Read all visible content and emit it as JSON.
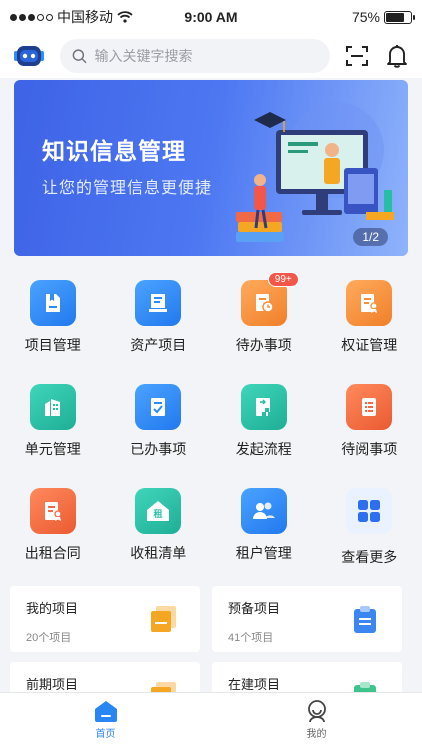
{
  "status": {
    "carrier": "中国移动",
    "time": "9:00 AM",
    "battery": "75%",
    "battery_level": 0.75
  },
  "header": {
    "search_placeholder": "输入关键字搜索"
  },
  "banner": {
    "title": "知识信息管理",
    "subtitle": "让您的管理信息更便捷",
    "page": "1/2"
  },
  "grid": [
    {
      "label": "项目管理",
      "icon": "folder-icon",
      "color": "#2d8cf5"
    },
    {
      "label": "资产项目",
      "icon": "asset-icon",
      "color": "#2d8cf5"
    },
    {
      "label": "待办事项",
      "icon": "todo-clock-icon",
      "color": "#f5913b",
      "badge": "99+"
    },
    {
      "label": "权证管理",
      "icon": "certificate-icon",
      "color": "#f5913b"
    },
    {
      "label": "单元管理",
      "icon": "building-icon",
      "color": "#26bfa6"
    },
    {
      "label": "已办事项",
      "icon": "done-icon",
      "color": "#2d8cf5"
    },
    {
      "label": "发起流程",
      "icon": "process-icon",
      "color": "#26bfa6"
    },
    {
      "label": "待阅事项",
      "icon": "list-icon",
      "color": "#f26a45"
    },
    {
      "label": "出租合同",
      "icon": "contract-icon",
      "color": "#f26a45"
    },
    {
      "label": "收租清单",
      "icon": "rent-house-icon",
      "color": "#26bfa6"
    },
    {
      "label": "租户管理",
      "icon": "tenants-icon",
      "color": "#2d8cf5"
    },
    {
      "label": "查看更多",
      "icon": "more-grid-icon",
      "color": "#2d8cf5"
    }
  ],
  "cards": [
    {
      "title": "我的项目",
      "count": "20个项目",
      "icon": "files-icon",
      "color": "#f5a623"
    },
    {
      "title": "预备项目",
      "count": "41个项目",
      "icon": "clipboard-icon",
      "color": "#3b86f0"
    },
    {
      "title": "前期项目",
      "count": "",
      "icon": "files-icon",
      "color": "#f5a623"
    },
    {
      "title": "在建项目",
      "count": "",
      "icon": "clipboard-icon",
      "color": "#3fc38d"
    }
  ],
  "tabbar": {
    "home": "首页",
    "mine": "我的"
  }
}
